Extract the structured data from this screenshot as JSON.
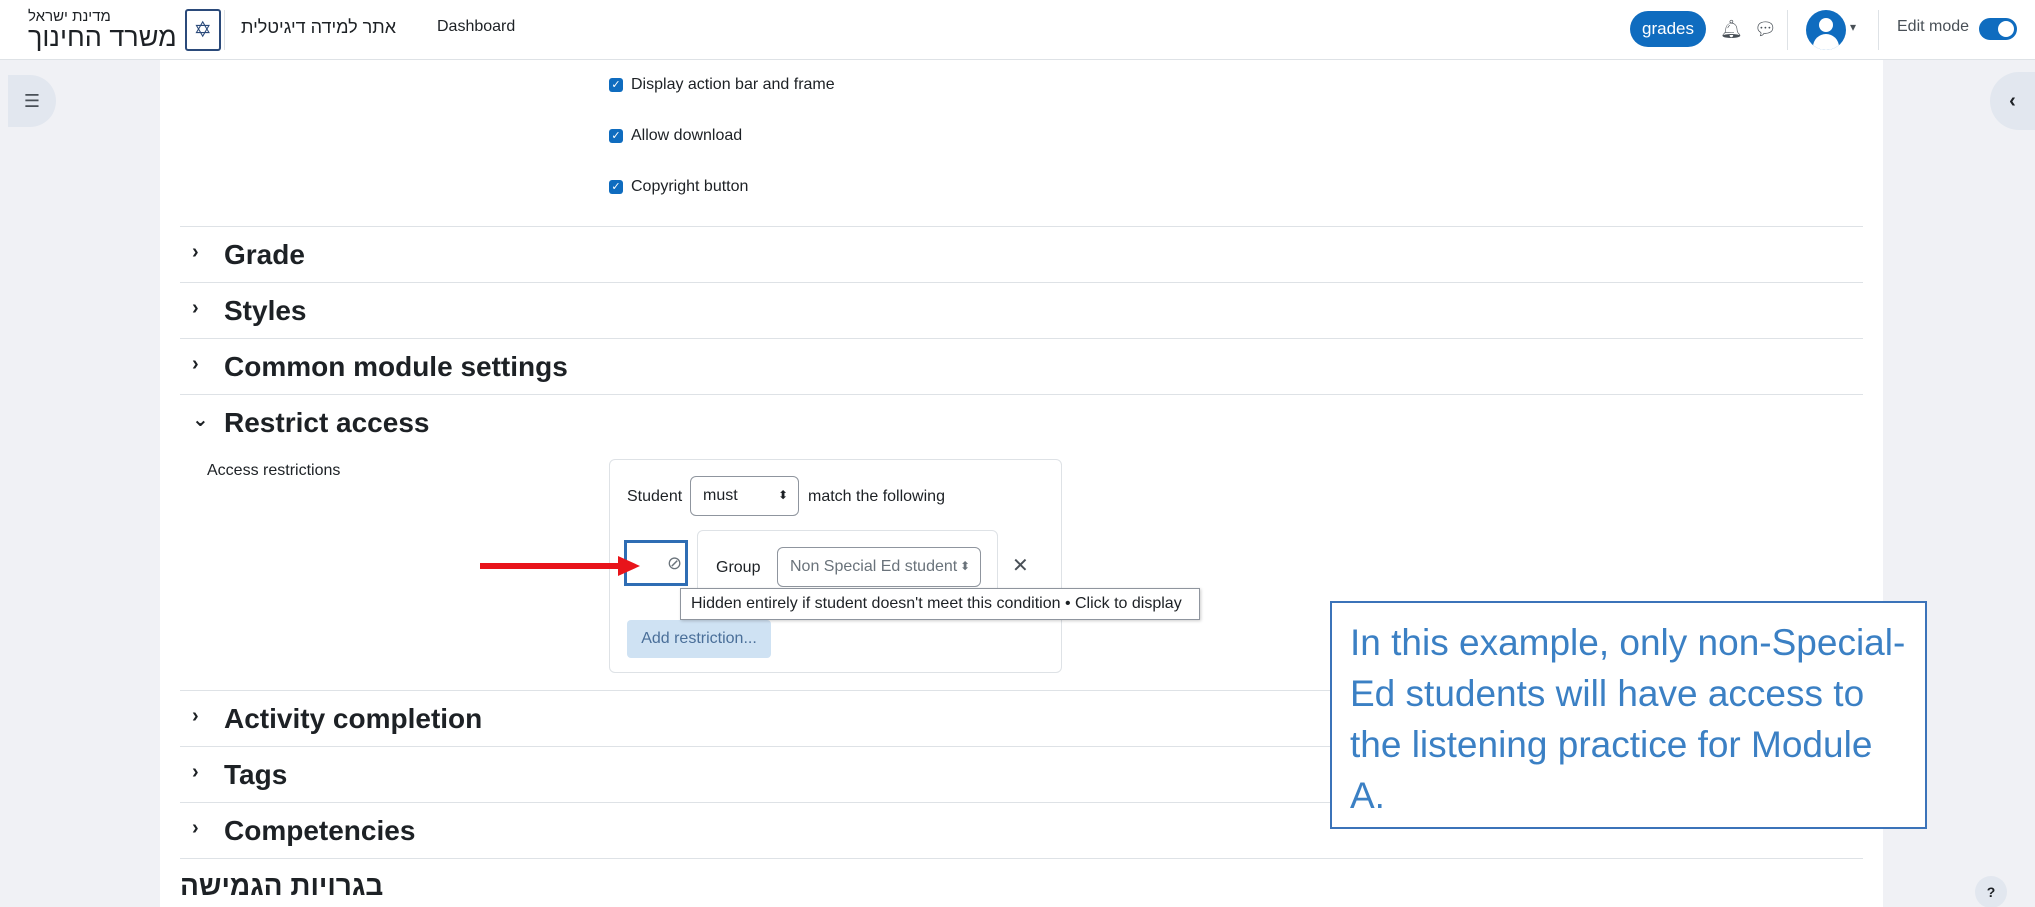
{
  "navbar": {
    "logo_small": "מדינת ישראל",
    "logo_big": "משרד החינוך",
    "site_link": "אתר למידה דיגיטלית",
    "dashboard": "Dashboard",
    "grades_label": "grades",
    "edit_mode_label": "Edit mode",
    "edit_mode_on": true
  },
  "options": [
    {
      "label": "Display action bar and frame",
      "checked": true
    },
    {
      "label": "Allow download",
      "checked": true
    },
    {
      "label": "Copyright button",
      "checked": true
    }
  ],
  "sections": {
    "grade": "Grade",
    "styles": "Styles",
    "common": "Common module settings",
    "restrict": "Restrict access",
    "activity": "Activity completion",
    "tags": "Tags",
    "competencies": "Competencies"
  },
  "restrict": {
    "access_label": "Access restrictions",
    "student": "Student",
    "must": "must",
    "match": "match the following",
    "group_label": "Group",
    "group_value": "Non Special Ed student",
    "tooltip": "Hidden entirely if student doesn't meet this condition • Click to display",
    "add_restriction": "Add restriction..."
  },
  "footer_heading": "בגרויות הגמישה",
  "callout": "In this example, only non-Special-Ed students will have access to the listening practice for Module A.",
  "help": "?",
  "colors": {
    "accent": "#0f6cbf",
    "callout_border": "#3b73b9",
    "callout_text": "#3b80c4",
    "arrow": "#e8141a"
  }
}
